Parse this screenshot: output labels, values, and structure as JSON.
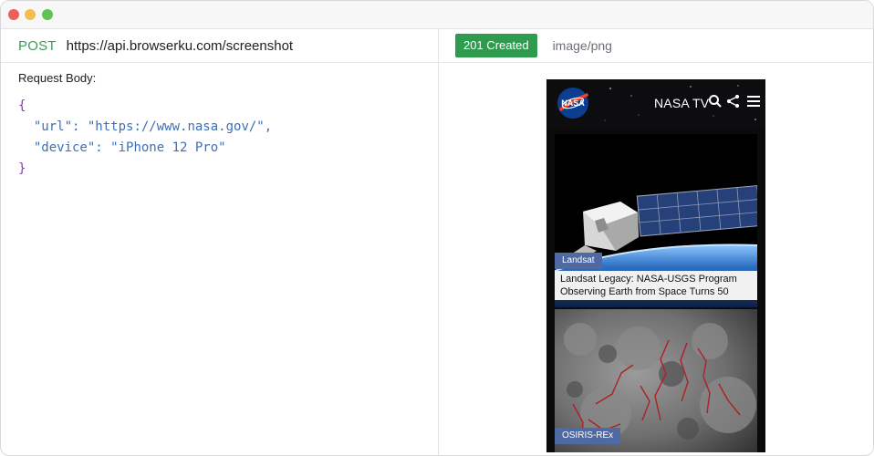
{
  "request": {
    "method": "POST",
    "url": "https://api.browserku.com/screenshot",
    "body_label": "Request Body:",
    "body": {
      "url_key": "\"url\"",
      "url_value": "\"https://www.nasa.gov/\"",
      "device_key": "\"device\"",
      "device_value": "\"iPhone 12 Pro\""
    }
  },
  "response": {
    "status": "201 Created",
    "content_type": "image/png"
  },
  "preview": {
    "site_header": "NASA TV",
    "articles": [
      {
        "tag": "Landsat",
        "title": "Landsat Legacy: NASA-USGS Program Observing Earth from Space Turns 50"
      },
      {
        "tag": "OSIRIS-REx"
      }
    ]
  },
  "colors": {
    "method": "#3c9a57",
    "status_badge": "#2f9b4e",
    "tag_bg": "#4f6aa3",
    "brace": "#7b3fa0",
    "json_text": "#3d6fb6"
  },
  "icons": {
    "window_controls": [
      "close-dot",
      "minimize-dot",
      "maximize-dot"
    ],
    "header": [
      "nasa-logo",
      "search-icon",
      "share-icon",
      "menu-icon"
    ]
  }
}
